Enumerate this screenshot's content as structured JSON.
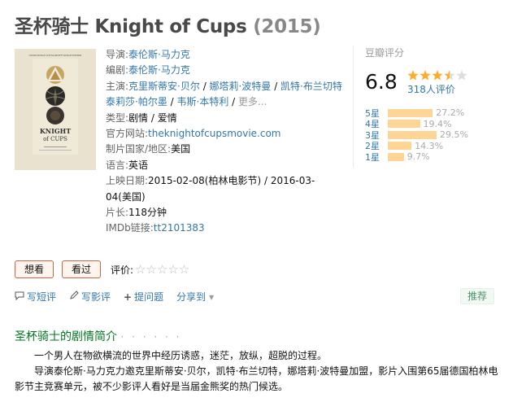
{
  "movie": {
    "title_cn": "圣杯骑士",
    "title_en": "Knight of Cups",
    "year": "(2015)"
  },
  "info": {
    "director_label": "导演:",
    "director": "泰伦斯·马力克",
    "writer_label": "编剧:",
    "writer": "泰伦斯·马力克",
    "cast_label": "主演:",
    "cast": [
      "克里斯蒂安·贝尔",
      "娜塔莉·波特曼",
      "凯特·布兰切特",
      "泰莉莎·帕尔墨",
      "韦斯·本特利"
    ],
    "cast_more": "更多...",
    "genre_label": "类型:",
    "genre": "剧情 / 爱情",
    "website_label": "官方网站:",
    "website": "theknightofcupsmovie.com",
    "country_label": "制片国家/地区:",
    "country": "美国",
    "language_label": "语言:",
    "language": "英语",
    "release_label": "上映日期:",
    "release_1": "2015-02-08(柏林电影节)",
    "release_sep": " / ",
    "release_2a": "2016-03-",
    "release_2b": "04(美国)",
    "runtime_label": "片长:",
    "runtime": "118分钟",
    "imdb_label": "IMDb链接:",
    "imdb": "tt2101383"
  },
  "rating": {
    "label": "豆瓣评分",
    "score": "6.8",
    "stars_value": 3.5,
    "votes": "318人评价",
    "breakdown": [
      {
        "label": "5星",
        "pct": "27.2%",
        "value": 27.2
      },
      {
        "label": "4星",
        "pct": "19.4%",
        "value": 19.4
      },
      {
        "label": "3星",
        "pct": "29.5%",
        "value": 29.5
      },
      {
        "label": "2星",
        "pct": "14.3%",
        "value": 14.3
      },
      {
        "label": "1星",
        "pct": "9.7%",
        "value": 9.7
      }
    ]
  },
  "buttons": {
    "want": "想看",
    "seen": "看过",
    "rate_label": "评价:",
    "empty_stars": "☆☆☆☆☆"
  },
  "actions": {
    "short_review": "写短评",
    "review": "写影评",
    "question": "提问题",
    "share": "分享到",
    "share_arrow": "▾",
    "recommend": "推荐"
  },
  "summary": {
    "heading": "圣杯骑士的剧情简介",
    "dots": "· · · · · ·",
    "p1": "一个男人在物欲横流的世界中经历诱惑，迷茫，放纵，超脱的过程。",
    "p2": "导演泰伦斯·马力克力邀克里斯蒂安·贝尔，凯特·布兰切特，娜塔莉·波特曼加盟，影片入围第65届德国柏林电影节主竞赛单元，被不少影评人看好是当届金熊奖的热门候选。"
  },
  "poster": {
    "small_top": "CHRISTIAN BALE   CATE BLANCHETT   NATALIE PORTMAN",
    "line1": "KNIGHT",
    "line2": "of CUPS"
  },
  "colors": {
    "link": "#3377aa",
    "star": "#ffac2d",
    "bar": "#ffd596",
    "green": "#007722"
  }
}
